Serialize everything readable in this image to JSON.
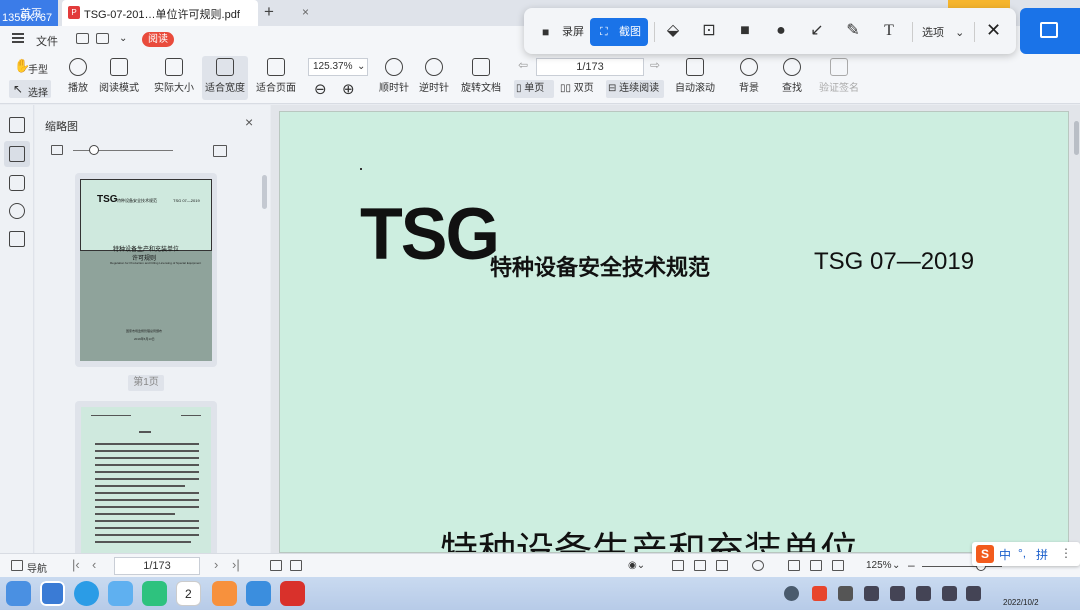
{
  "tabs": {
    "home_label": "首页",
    "home_sub": "1359X767",
    "file_name": "TSG-07-201…单位许可规则.pdf",
    "pdf_icon": "P"
  },
  "menu": {
    "file": "文件",
    "read": "阅读"
  },
  "snapbar": {
    "record": "录屏",
    "screenshot": "截图",
    "text_tool": "T",
    "options": "选项",
    "close": "✕"
  },
  "toolbar": {
    "hand": "手型",
    "select": "选择",
    "play": "播放",
    "read_mode": "阅读模式",
    "actual_size": "实际大小",
    "fit_width": "适合宽度",
    "fit_page": "适合页面",
    "zoom_value": "125.37%",
    "page_value": "1/173",
    "rotate_cw": "顺时针",
    "rotate_ccw": "逆时针",
    "rotate_doc": "旋转文档",
    "single_page": "单页",
    "double_page": "双页",
    "continuous": "连续阅读",
    "auto_scroll": "自动滚动",
    "background": "背景",
    "find": "查找",
    "verify_sign": "验证签名"
  },
  "thumbnail_panel": {
    "title": "缩略图",
    "page1_label": "第1页",
    "thumb_tsg": "TSG",
    "thumb_sub": "特种设备安全技术规范",
    "thumb_code": "TSG 07—2019",
    "thumb_title1": "特种设备生产和充装单位",
    "thumb_title2": "许可规则",
    "thumb_en": "Regulation for Production and Filling Licensing of Special Equipment",
    "thumb_org": "国家市场监督管理总局颁布",
    "thumb_date": "2019年5月13日"
  },
  "document": {
    "tsg": "TSG",
    "subtitle": "特种设备安全技术规范",
    "code": "TSG 07—2019",
    "title": "特种设备生产和充装单位"
  },
  "statusbar": {
    "nav": "导航",
    "page": "1/173",
    "zoom": "125%"
  },
  "ime": {
    "logo": "S",
    "mode": "中",
    "punct": "°,",
    "pinyin": "拼"
  },
  "taskbar": {
    "calendar_day": "2",
    "date": "2022/10/2"
  },
  "colors": {
    "accent": "#1a73e8",
    "read_pill": "#e94b3c",
    "page_bg": "#cdeee0"
  }
}
